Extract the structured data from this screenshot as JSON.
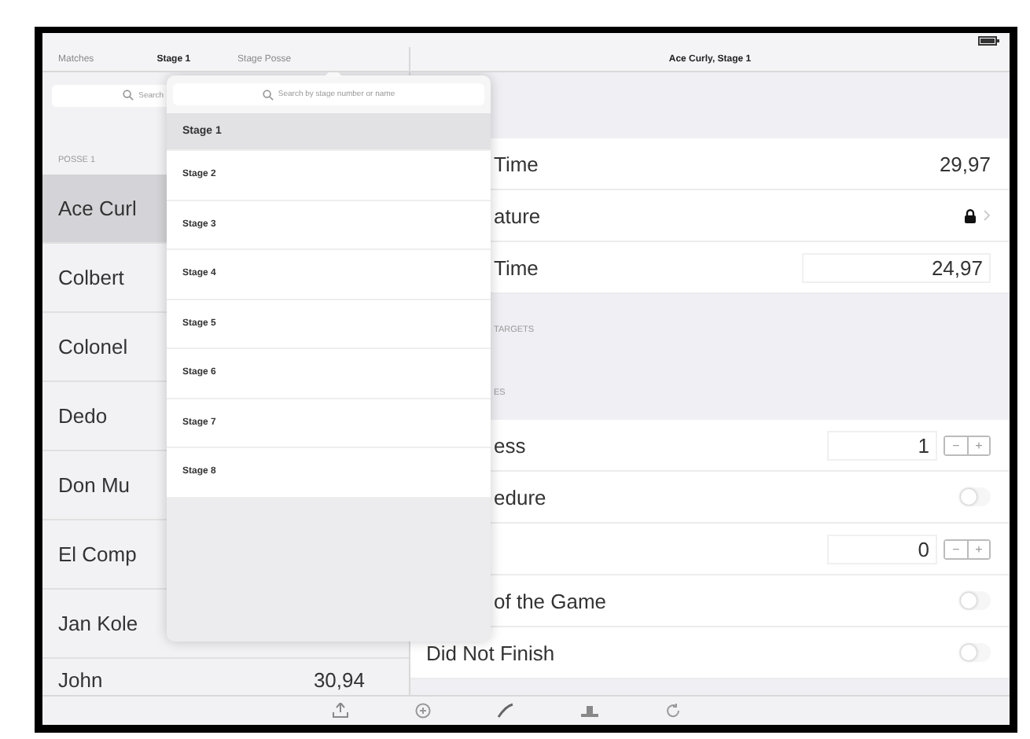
{
  "nav": {
    "items": [
      {
        "label": "Matches",
        "selected": false
      },
      {
        "label": "Stage 1",
        "selected": true
      },
      {
        "label": "Stage Posse",
        "selected": false
      }
    ],
    "title": "Ace Curly, Stage 1"
  },
  "sidebar": {
    "search": {
      "placeholder": "Search"
    },
    "section": "POSSE 1",
    "items": [
      {
        "name": "Ace Curl",
        "selected": true
      },
      {
        "name": "Colbert",
        "selected": false
      },
      {
        "name": "Colonel",
        "selected": false
      },
      {
        "name": "Dedo",
        "selected": false
      },
      {
        "name": "Don Mu",
        "selected": false
      },
      {
        "name": "El Comp",
        "selected": false
      },
      {
        "name": "Jan Kole",
        "selected": false
      },
      {
        "name": "John",
        "value": "30,94",
        "selected": false
      }
    ]
  },
  "popover": {
    "search": {
      "placeholder": "Search by stage number or name"
    },
    "items": [
      {
        "label": "Stage 1",
        "selected": true
      },
      {
        "label": "Stage 2",
        "selected": false
      },
      {
        "label": "Stage 3",
        "selected": false
      },
      {
        "label": "Stage 4",
        "selected": false
      },
      {
        "label": "Stage 5",
        "selected": false
      },
      {
        "label": "Stage 6",
        "selected": false
      },
      {
        "label": "Stage 7",
        "selected": false
      },
      {
        "label": "Stage 8",
        "selected": false
      }
    ]
  },
  "detail": {
    "groups": [
      {
        "rows": [
          {
            "kind": "value",
            "label": "Time",
            "value": "29,97"
          },
          {
            "kind": "locked",
            "label": "ature"
          },
          {
            "kind": "field",
            "label": "Time",
            "value": "24,97"
          }
        ]
      },
      {
        "header": "TARGETS"
      },
      {
        "header": "ES",
        "rows": [
          {
            "kind": "stepper",
            "label": "ess",
            "value": "1",
            "buttons": [
              "−",
              "+"
            ]
          },
          {
            "kind": "toggle",
            "label": "edure",
            "on": false
          },
          {
            "kind": "stepper",
            "value": "0",
            "buttons": [
              "−",
              "+"
            ]
          },
          {
            "kind": "toggle",
            "label": "of the Game",
            "on": false
          },
          {
            "kind": "toggle",
            "label": "Did Not Finish",
            "on": false
          }
        ]
      }
    ]
  }
}
